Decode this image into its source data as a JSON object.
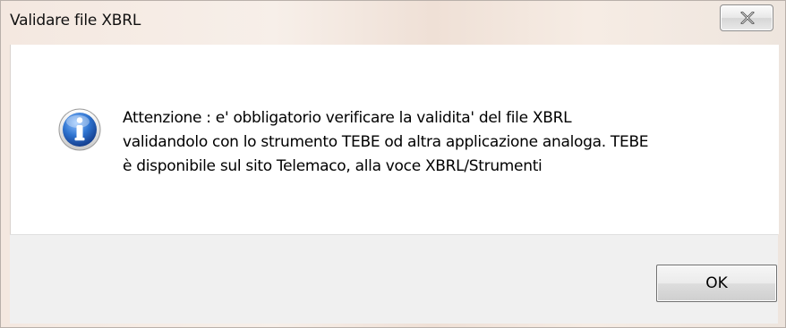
{
  "dialog": {
    "title": "Validare file XBRL",
    "message_lines": [
      "Attenzione : e' obbligatorio verificare la validita' del file XBRL",
      "validandolo con lo strumento TEBE od altra applicazione analoga. TEBE",
      "è disponibile sul sito Telemaco, alla voce XBRL/Strumenti"
    ],
    "icon": "information-icon",
    "ok_label": "OK",
    "close_icon": "close-icon"
  },
  "colors": {
    "icon_blue": "#1f5fb4",
    "footer_bg": "#f0f0f0",
    "content_bg": "#ffffff"
  }
}
